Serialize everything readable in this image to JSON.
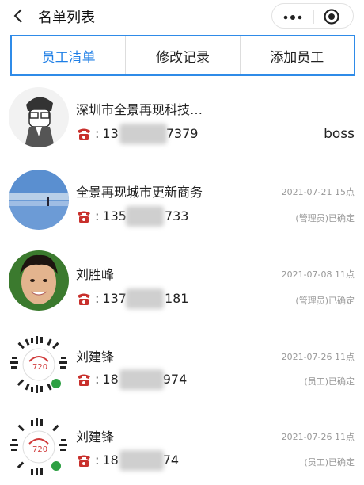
{
  "header": {
    "title": "名单列表",
    "back_icon": "chevron-left-icon",
    "more_icon": "more-dots-icon",
    "target_icon": "target-icon"
  },
  "tabs": [
    {
      "label": "员工清单",
      "active": true
    },
    {
      "label": "修改记录",
      "active": false
    },
    {
      "label": "添加员工",
      "active": false
    }
  ],
  "accent_color": "#2f8be8",
  "phone_icon": "telephone-icon",
  "items": [
    {
      "name": "深圳市全景再现科技…",
      "phone": "13",
      "phone_end": "7379",
      "time": "",
      "role": "boss"
    },
    {
      "name": "全景再现城市更新商务",
      "phone": "135",
      "phone_end": "733",
      "time": "2021-07-21 15点",
      "role": "(管理员)已确定"
    },
    {
      "name": "刘胜峰",
      "phone": "137",
      "phone_end": "181",
      "time": "2021-07-08 11点",
      "role": "(管理员)已确定"
    },
    {
      "name": "刘建锋",
      "phone": "18",
      "phone_end": "974",
      "time": "2021-07-26 11点",
      "role": "(员工)已确定"
    },
    {
      "name": "刘建锋",
      "phone": "18",
      "phone_end": "74",
      "time": "2021-07-26 11点",
      "role": "(员工)已确定"
    }
  ]
}
